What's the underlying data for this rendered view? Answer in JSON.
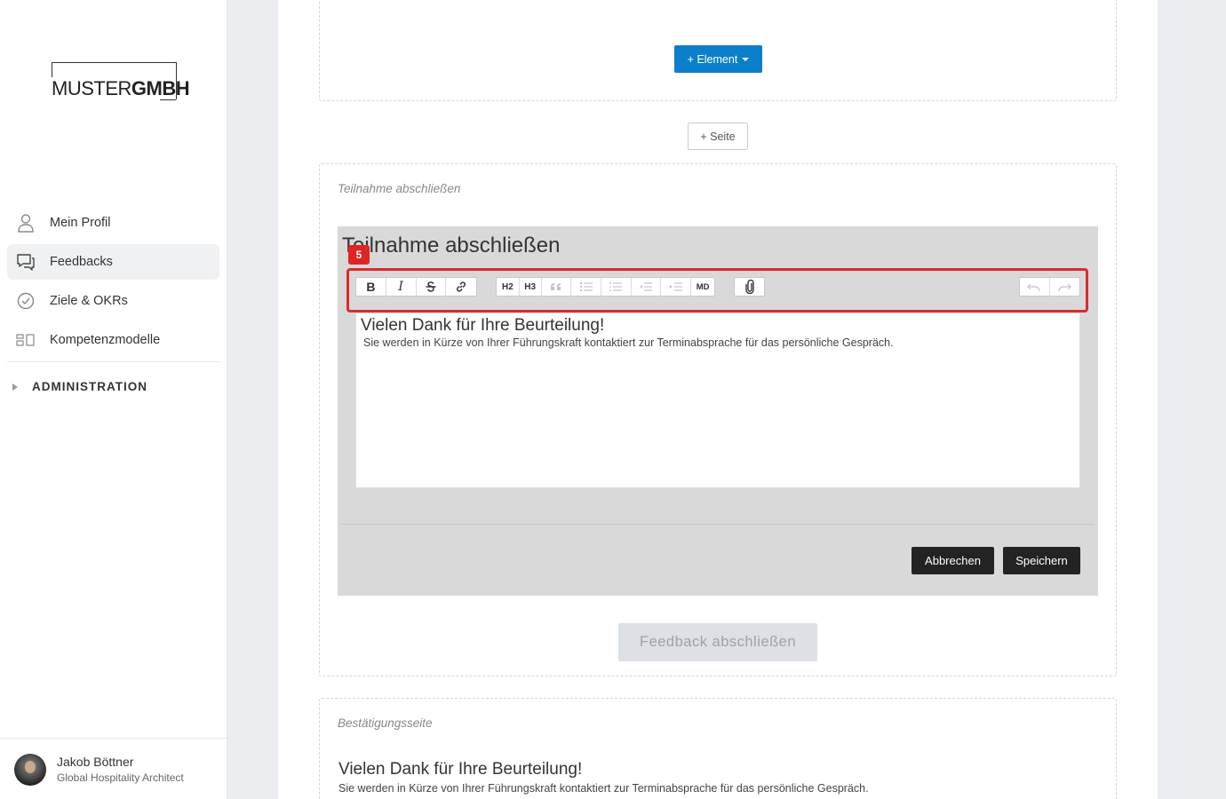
{
  "logo": {
    "part1": "MUSTER",
    "part2": "GMBH"
  },
  "nav": {
    "items": [
      {
        "label": "Mein Profil",
        "icon": "user-icon"
      },
      {
        "label": "Feedbacks",
        "icon": "chat-icon",
        "active": true
      },
      {
        "label": "Ziele & OKRs",
        "icon": "check-circle-icon"
      },
      {
        "label": "Kompetenzmodelle",
        "icon": "model-icon"
      }
    ],
    "admin_label": "ADMINISTRATION"
  },
  "user": {
    "name": "Jakob Böttner",
    "role": "Global Hospitality Architect"
  },
  "top": {
    "element_button": "+ Element",
    "seite_button": "+ Seite"
  },
  "finish_section": {
    "label": "Teilnahme abschließen",
    "editor_title": "Teilnahme abschließen",
    "badge": "5",
    "toolbar": {
      "bold": "B",
      "italic": "I",
      "h2": "H2",
      "h3": "H3",
      "md": "MD"
    },
    "content_heading": "Vielen Dank für Ihre Beurteilung!",
    "content_text": "Sie werden in Kürze von Ihrer Führungskraft kontaktiert zur Terminabsprache für das persönliche Gespräch.",
    "cancel_button": "Abbrechen",
    "save_button": "Speichern",
    "finish_button": "Feedback abschließen"
  },
  "confirmation": {
    "label": "Bestätigungsseite",
    "heading": "Vielen Dank für Ihre Beurteilung!",
    "text": "Sie werden in Kürze von Ihrer Führungskraft kontaktiert zur Terminabsprache für das persönliche Gespräch."
  },
  "colors": {
    "accent": "#0b7fcb",
    "highlight": "#dd2a2a",
    "dark_button": "#232323"
  }
}
